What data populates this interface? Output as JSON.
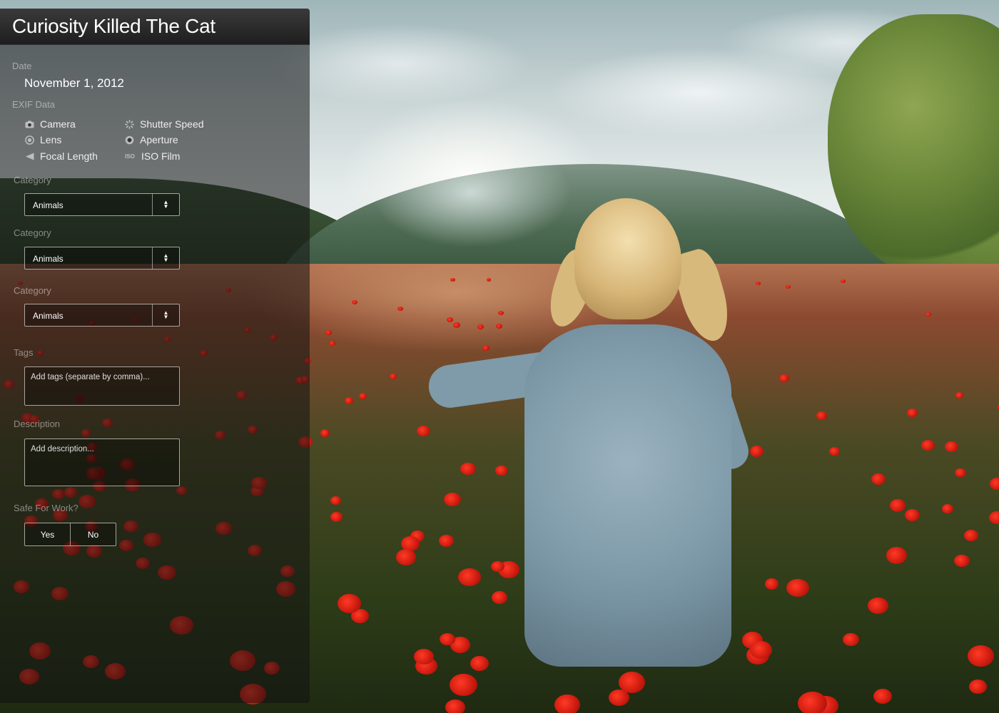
{
  "title": "Curiosity Killed The Cat",
  "date": {
    "label": "Date",
    "value": "November 1, 2012"
  },
  "exif": {
    "label": "EXIF Data",
    "items": [
      {
        "label": "Camera",
        "icon": "camera-icon"
      },
      {
        "label": "Shutter Speed",
        "icon": "shutter-speed-icon"
      },
      {
        "label": "Lens",
        "icon": "lens-icon"
      },
      {
        "label": "Aperture",
        "icon": "aperture-icon"
      },
      {
        "label": "Focal Length",
        "icon": "focal-length-icon"
      },
      {
        "label": "ISO Film",
        "icon": "iso-icon",
        "badge": "ISO"
      }
    ]
  },
  "categories": [
    {
      "label": "Category",
      "value": "Animals"
    },
    {
      "label": "Category",
      "value": "Animals"
    },
    {
      "label": "Category",
      "value": "Animals"
    }
  ],
  "tags": {
    "label": "Tags",
    "placeholder": "Add tags (separate by comma)..."
  },
  "description": {
    "label": "Description",
    "placeholder": "Add description..."
  },
  "sfw": {
    "label": "Safe For Work?",
    "yes": "Yes",
    "no": "No"
  }
}
